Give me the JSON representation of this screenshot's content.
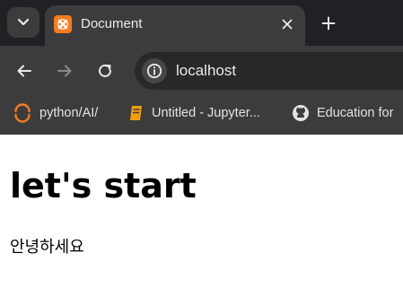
{
  "browser": {
    "tab": {
      "title": "Document",
      "favicon": "xampp-icon"
    },
    "address_bar": {
      "url": "localhost"
    },
    "icons": {
      "tab_search": "chevron-down-icon",
      "close": "close-icon",
      "new_tab": "plus-icon",
      "back": "arrow-left-icon",
      "forward": "arrow-right-icon",
      "reload": "reload-icon",
      "site_info": "site-info-icon"
    },
    "bookmarks": [
      {
        "label": "python/AI/",
        "icon": "spinner-icon"
      },
      {
        "label": "Untitled - Jupyter...",
        "icon": "jupyter-book-icon"
      },
      {
        "label": "Education for",
        "icon": "github-icon"
      }
    ],
    "colors": {
      "frame": "#202124",
      "toolbar": "#3c3c3c",
      "text": "#e8eaed",
      "favicon_orange": "#f57c20",
      "bookmark_spinner": "#f57c20",
      "jupyter_orange": "#f39c12"
    }
  },
  "page": {
    "heading": "let's start",
    "paragraph": "안녕하세요"
  }
}
